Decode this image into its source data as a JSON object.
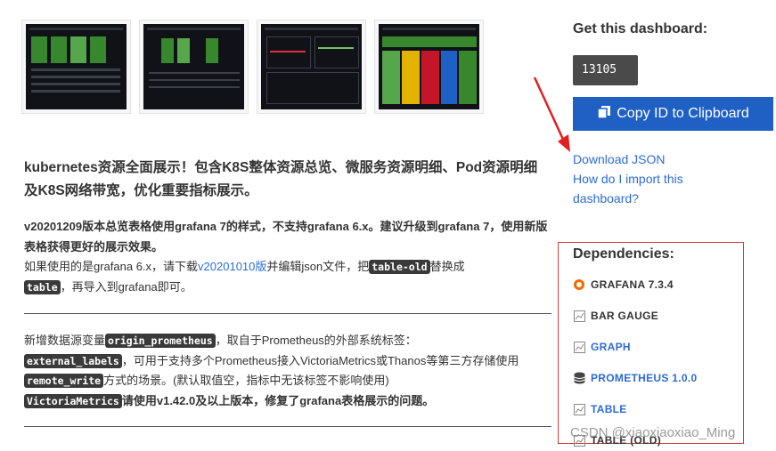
{
  "main": {
    "headline": "kubernetes资源全面展示！包含K8S整体资源总览、微服务资源明细、Pod资源明细及K8S网络带宽，优化重要指标展示。",
    "version_note": "v20201209版本总览表格使用grafana 7的样式，不支持grafana 6.x。建议升级到grafana 7，使用新版表格获得更好的展示效果。",
    "old_version_prefix": "如果使用的是grafana 6.x，请下载",
    "old_version_link": "v20201010版",
    "old_version_mid": "并编辑json文件，把",
    "old_version_code1": "table-old",
    "old_version_mid2": "替换成",
    "old_version_code2": "table",
    "old_version_suffix": "，再导入到grafana即可。",
    "ds_prefix": "新增数据源变量",
    "ds_code1": "origin_prometheus",
    "ds_mid1": "，取自于Prometheus的外部系统标签：",
    "ds_code2": "external_labels",
    "ds_mid2": "，可用于支持多个Prometheus接入VictoriaMetrics或Thanos等第三方存储使用",
    "ds_code3": "remote_write",
    "ds_mid3": "方式的场景。(默认取值空，指标中无该标签不影响使用)",
    "ds_code4": "VictoriaMetrics",
    "ds_suffix": "请使用v1.42.0及以上版本，修复了grafana表格展示的问题。"
  },
  "sidebar": {
    "get_title": "Get this dashboard:",
    "dashboard_id": "13105",
    "copy_button": "Copy ID to Clipboard",
    "download_json": "Download JSON",
    "import_help_1": "How do I import this",
    "import_help_2": "dashboard?",
    "dependencies_title": "Dependencies:",
    "dependencies": [
      {
        "label": "GRAFANA 7.3.4",
        "icon": "grafana-icon",
        "color": "#333333"
      },
      {
        "label": "BAR GAUGE",
        "icon": "panel-icon",
        "color": "#333333"
      },
      {
        "label": "GRAPH",
        "icon": "panel-icon",
        "color": "#2c6bd6"
      },
      {
        "label": "PROMETHEUS 1.0.0",
        "icon": "database-icon",
        "color": "#2c6bd6"
      },
      {
        "label": "TABLE",
        "icon": "panel-icon",
        "color": "#2c6bd6"
      },
      {
        "label": "TABLE (OLD)",
        "icon": "panel-icon",
        "color": "#333333"
      }
    ]
  },
  "watermark": "CSDN @xiaoxiaoxiao_Ming"
}
